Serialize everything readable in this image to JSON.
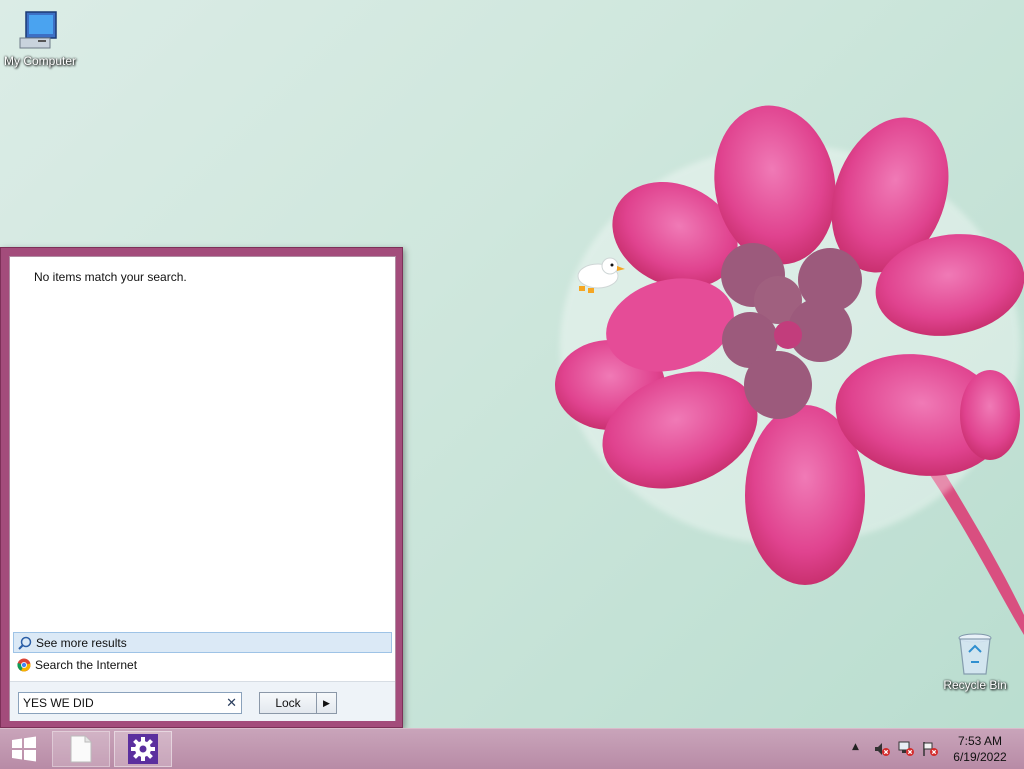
{
  "desktop": {
    "icons": [
      {
        "label": "My Computer",
        "icon": "computer-icon"
      },
      {
        "label": "Recycle Bin",
        "icon": "recycle-bin-icon"
      }
    ]
  },
  "start_menu": {
    "no_results_text": "No items match your search.",
    "see_more_label": "See more results",
    "search_internet_label": "Search the Internet",
    "search": {
      "value": "YES WE DID"
    },
    "power_button_label": "Lock",
    "accent_color": "#a34c7b"
  },
  "taskbar": {
    "pinned": [
      {
        "icon": "windows-logo-icon"
      },
      {
        "icon": "blank-document-icon"
      },
      {
        "icon": "gear-icon"
      }
    ],
    "tray_icons": [
      "show-hidden-icons-arrow",
      "speaker-muted-icon",
      "network-error-icon",
      "action-center-flag-icon"
    ],
    "clock": {
      "time": "7:53 AM",
      "date": "6/19/2022"
    }
  }
}
